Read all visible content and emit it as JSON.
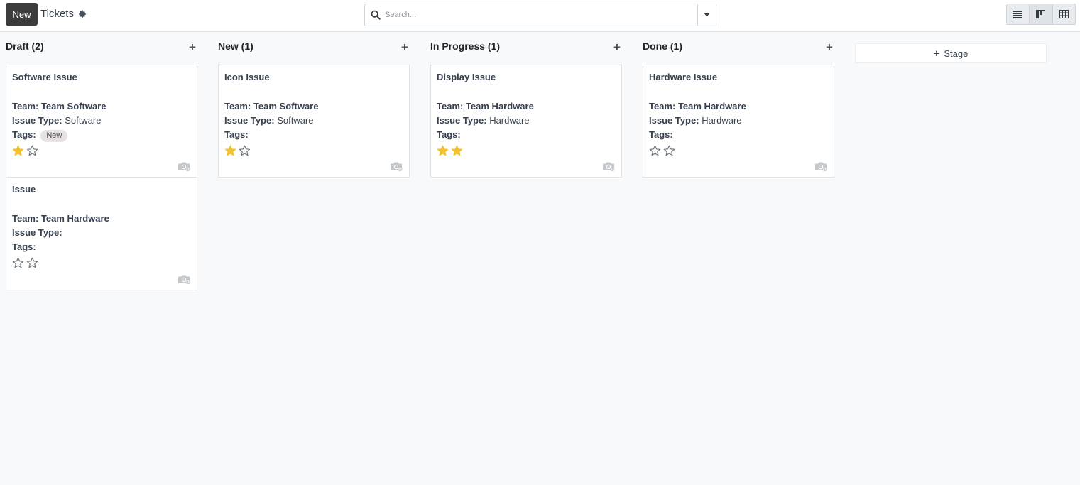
{
  "header": {
    "new_label": "New",
    "title": "Tickets",
    "settings_icon": "gear-icon",
    "search_placeholder": "Search...",
    "search_icon": "search-icon",
    "views": [
      "list-view-icon",
      "kanban-view-icon",
      "pivot-view-icon"
    ]
  },
  "colors": {
    "star_filled": "#f3c130",
    "star_empty": "#6c757d",
    "new_button": "#3c3c3c"
  },
  "columns": [
    {
      "title": "Draft (2)",
      "cards": [
        {
          "title": "Software Issue",
          "team_label": "Team:",
          "team": "Team Software",
          "type_label": "Issue Type:",
          "type": "Software",
          "tags_label": "Tags:",
          "tags": [
            "New"
          ],
          "priority": 1
        },
        {
          "title": "Issue",
          "team_label": "Team:",
          "team": "Team Hardware",
          "type_label": "Issue Type:",
          "type": "",
          "tags_label": "Tags:",
          "tags": [],
          "priority": 0
        }
      ]
    },
    {
      "title": "New (1)",
      "cards": [
        {
          "title": "Icon Issue",
          "team_label": "Team:",
          "team": "Team Software",
          "type_label": "Issue Type:",
          "type": "Software",
          "tags_label": "Tags:",
          "tags": [],
          "priority": 1
        }
      ]
    },
    {
      "title": "In Progress (1)",
      "cards": [
        {
          "title": "Display Issue",
          "team_label": "Team:",
          "team": "Team Hardware",
          "type_label": "Issue Type:",
          "type": "Hardware",
          "tags_label": "Tags:",
          "tags": [],
          "priority": 2
        }
      ]
    },
    {
      "title": "Done (1)",
      "cards": [
        {
          "title": "Hardware Issue",
          "team_label": "Team:",
          "team": "Team Hardware",
          "type_label": "Issue Type:",
          "type": "Hardware",
          "tags_label": "Tags:",
          "tags": [],
          "priority": 0
        }
      ]
    }
  ],
  "add_stage_label": "Stage"
}
